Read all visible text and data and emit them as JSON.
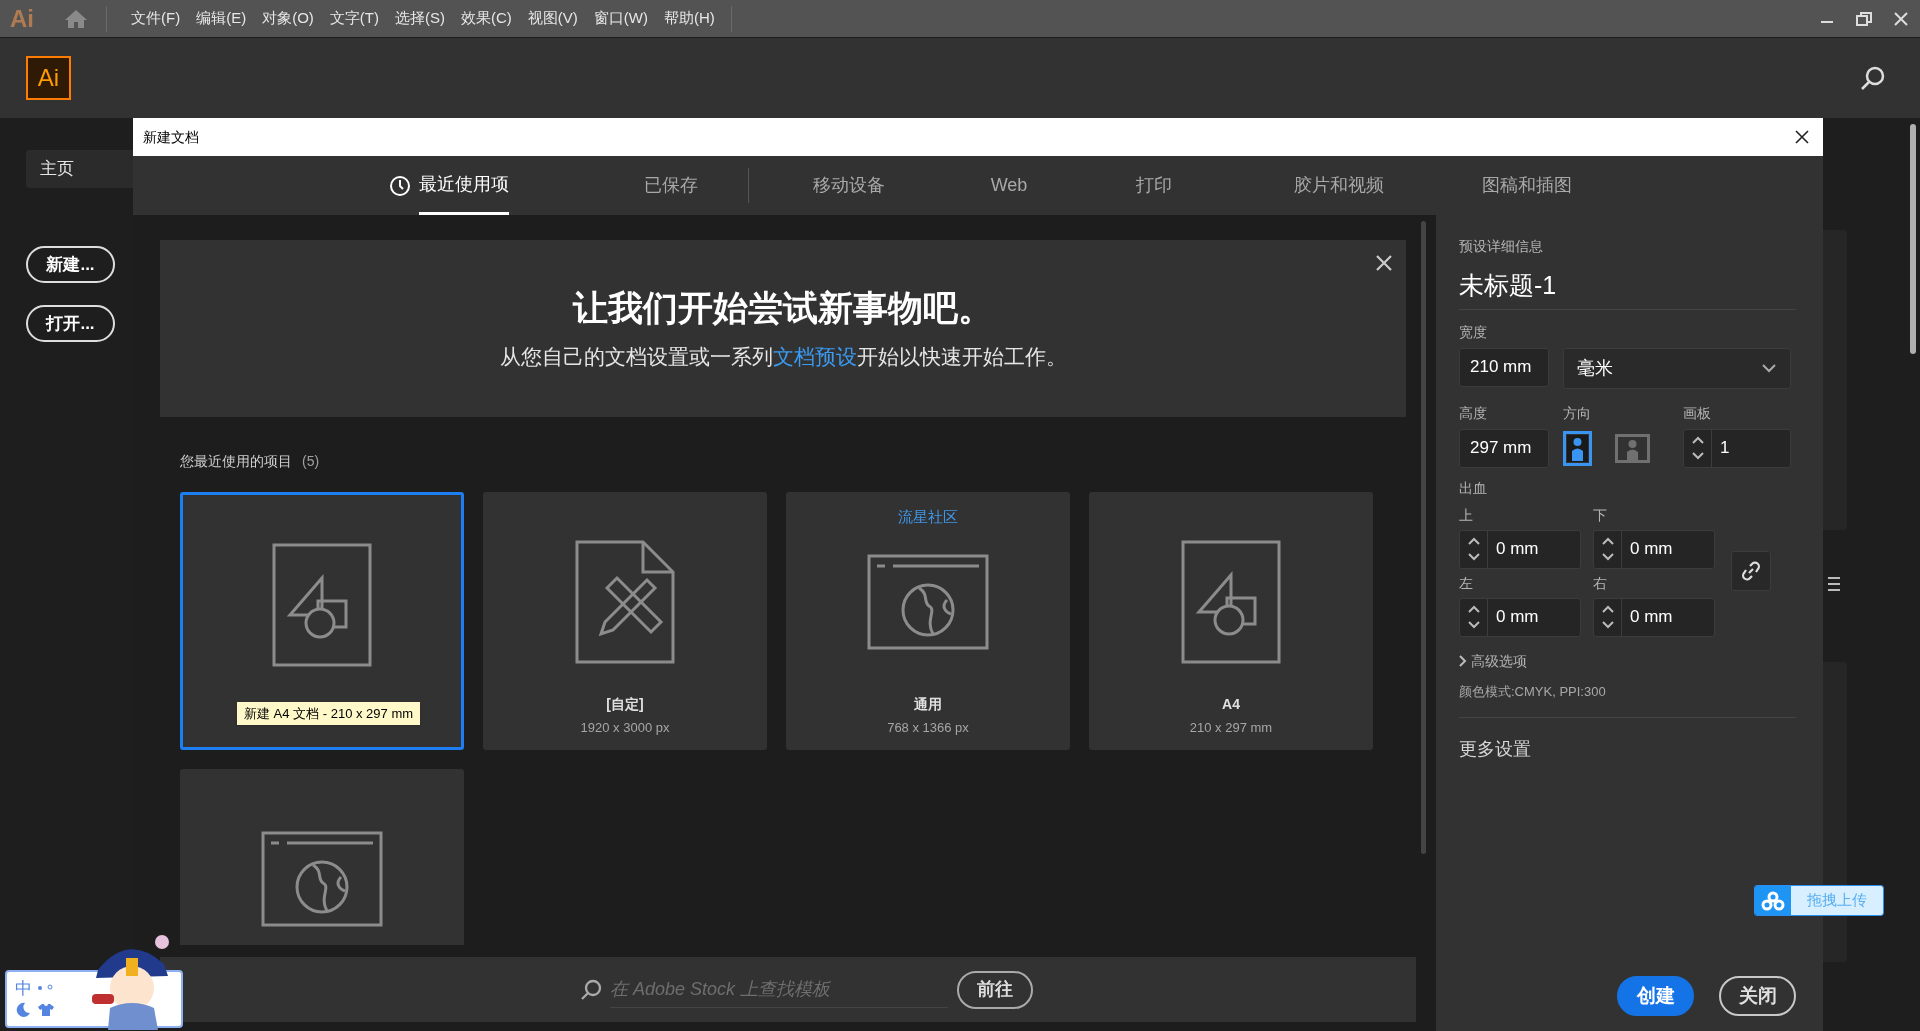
{
  "app_menu": {
    "logo": "Ai",
    "items": [
      "文件(F)",
      "编辑(E)",
      "对象(O)",
      "文字(T)",
      "选择(S)",
      "效果(C)",
      "视图(V)",
      "窗口(W)",
      "帮助(H)"
    ]
  },
  "header": {
    "logo": "Ai"
  },
  "home_sidebar": {
    "tab": "主页",
    "buttons": [
      "新建...",
      "打开..."
    ]
  },
  "dialog": {
    "title": "新建文档",
    "tabs": [
      {
        "label": "最近使用项",
        "selected": true
      },
      {
        "label": "已保存",
        "selected": false
      },
      {
        "label": "移动设备",
        "selected": false
      },
      {
        "label": "Web",
        "selected": false
      },
      {
        "label": "打印",
        "selected": false
      },
      {
        "label": "胶片和视频",
        "selected": false
      },
      {
        "label": "图稿和插图",
        "selected": false
      }
    ],
    "banner": {
      "title": "让我们开始尝试新事物吧。",
      "text_before": "从您自己的文档设置或一系列",
      "link": "文档预设",
      "text_after": "开始以快速开始工作。"
    },
    "recent": {
      "heading": "您最近使用的项目",
      "count": "(5)",
      "items": [
        {
          "kind": "document",
          "selected": true
        },
        {
          "kind": "custom",
          "selected": false,
          "name": "[自定]",
          "size": "1920 x 3000 px"
        },
        {
          "kind": "web",
          "selected": false,
          "badge": "流星社区",
          "name": "通用",
          "size": "768 x 1366 px"
        },
        {
          "kind": "document",
          "selected": false,
          "name": "A4",
          "size": "210 x 297 mm"
        },
        {
          "kind": "web",
          "selected": false
        }
      ]
    },
    "tooltip": "新建 A4 文档 - 210 x 297 mm",
    "stock_search": {
      "placeholder": "在 Adobe Stock 上查找模板",
      "button": "前往"
    },
    "preset": {
      "heading": "预设详细信息",
      "name": "未标题-1",
      "width_label": "宽度",
      "width": "210 mm",
      "unit": "毫米",
      "height_label": "高度",
      "height": "297 mm",
      "orientation_label": "方向",
      "orientations": [
        {
          "kind": "portrait",
          "selected": true
        },
        {
          "kind": "landscape",
          "selected": false
        }
      ],
      "artboards_label": "画板",
      "artboards": "1",
      "bleed_label": "出血",
      "bleed": [
        {
          "label": "上",
          "value": "0 mm"
        },
        {
          "label": "下",
          "value": "0 mm"
        },
        {
          "label": "左",
          "value": "0 mm"
        },
        {
          "label": "右",
          "value": "0 mm"
        }
      ],
      "advanced": "高级选项",
      "color_info": "颜色模式:CMYK, PPI:300",
      "more_settings": "更多设置"
    },
    "buttons": [
      {
        "label": "创建",
        "kind": "primary"
      },
      {
        "label": "关闭",
        "kind": "secondary"
      }
    ]
  },
  "ime": {
    "label": "中"
  },
  "upload_widget": {
    "label": "拖拽上传"
  }
}
